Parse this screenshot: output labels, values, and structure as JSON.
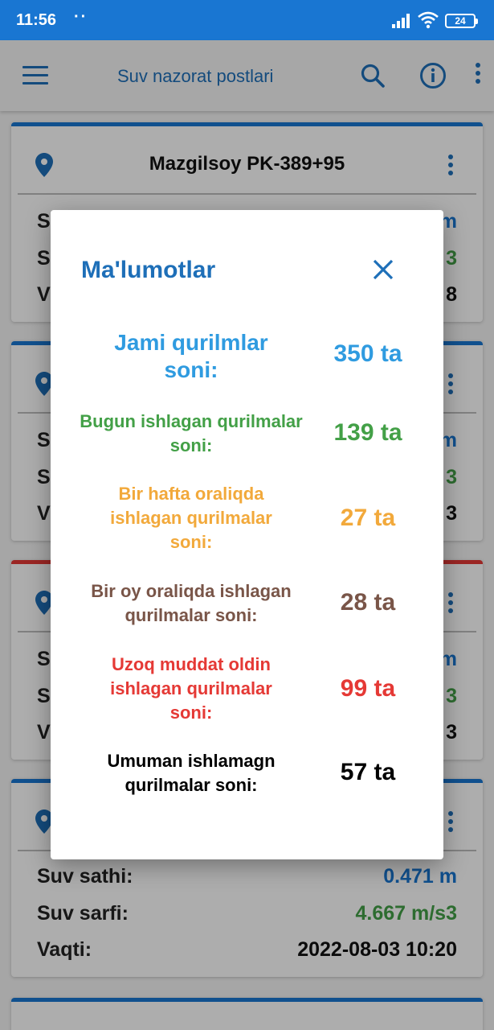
{
  "status_bar": {
    "time": "11:56",
    "dots": "··",
    "battery": "24"
  },
  "app_bar": {
    "title": "Suv nazorat postlari"
  },
  "cards": [
    {
      "title": "Mazgilsoy PK-389+95",
      "accent": "#1976d2",
      "rows": [
        {
          "label": "S",
          "value": "m",
          "color": "#1976d2"
        },
        {
          "label": "S",
          "value": "3",
          "color": "#43a047"
        },
        {
          "label": "V",
          "value": "8",
          "color": "#111111"
        }
      ]
    },
    {
      "title": "",
      "accent": "#1976d2",
      "rows": [
        {
          "label": "S",
          "value": "m",
          "color": "#1976d2"
        },
        {
          "label": "S",
          "value": "3",
          "color": "#43a047"
        },
        {
          "label": "V",
          "value": "3",
          "color": "#111111"
        }
      ]
    },
    {
      "title": "",
      "accent": "#e53935",
      "rows": [
        {
          "label": "S",
          "value": "m",
          "color": "#1976d2"
        },
        {
          "label": "S",
          "value": "3",
          "color": "#43a047"
        },
        {
          "label": "V",
          "value": "3",
          "color": "#111111"
        }
      ]
    },
    {
      "title": "",
      "accent": "#1976d2",
      "rows": [
        {
          "label": "Suv sathi:",
          "value": "0.471 m",
          "color": "#1976d2"
        },
        {
          "label": "Suv sarfi:",
          "value": "4.667 m/s3",
          "color": "#43a047"
        },
        {
          "label": "Vaqti:",
          "value": "2022-08-03 10:20",
          "color": "#111111"
        }
      ]
    },
    {
      "title": "",
      "accent": "#1976d2",
      "rows": []
    }
  ],
  "dialog": {
    "title": "Ma'lumotlar",
    "stats": [
      {
        "label": "Jami qurilmlar soni:",
        "value": "350 ta",
        "color": "#2f9be0"
      },
      {
        "label": "Bugun ishlagan qurilmalar soni:",
        "value": "139 ta",
        "color": "#43a047"
      },
      {
        "label": "Bir hafta oraliqda ishlagan qurilmalar soni:",
        "value": "27 ta",
        "color": "#f2a93b"
      },
      {
        "label": "Bir oy oraliqda ishlagan qurilmalar soni:",
        "value": "28 ta",
        "color": "#795548"
      },
      {
        "label": "Uzoq muddat oldin ishlagan qurilmalar soni:",
        "value": "99 ta",
        "color": "#e53935"
      },
      {
        "label": "Umuman ishlamagn qurilmalar soni:",
        "value": "57 ta",
        "color": "#000000"
      }
    ]
  }
}
